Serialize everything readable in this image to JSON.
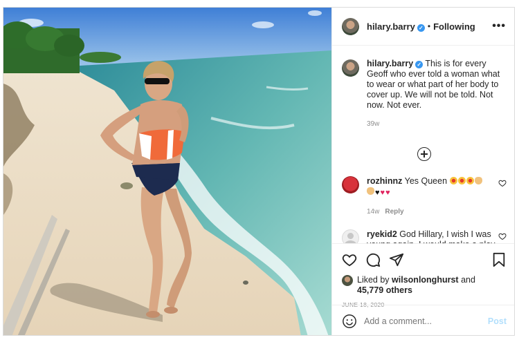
{
  "post": {
    "username": "hilary.barry",
    "follow_separator": "•",
    "follow_label": "Following",
    "more_label": "•••",
    "verified_mark": "✓"
  },
  "caption": {
    "username": "hilary.barry",
    "text": "This is for every Geoff who ever told a woman what to wear or what part of her body to cover up. We will not be told. Not now. Not ever.",
    "time": "39w"
  },
  "comments": [
    {
      "username": "rozhinnz",
      "text": "Yes Queen",
      "emoji_line1": [
        "star-struck",
        "star-struck",
        "star-struck",
        "clapping"
      ],
      "emoji_line2": [
        "clapping",
        "black-heart",
        "red-heart",
        "red-heart"
      ],
      "time": "14w",
      "reply_label": "Reply"
    },
    {
      "username": "ryekid2",
      "text": "God Hillary, I wish I was young again, I would make a play for you. You have got the x factor. Stuff all those deranged thinking"
    }
  ],
  "likes": {
    "prefix": "Liked by",
    "user": "wilsonlonghurst",
    "conj": "and",
    "count": "45,779 others"
  },
  "date": "JUNE 18, 2020",
  "add_comment": {
    "placeholder": "Add a comment...",
    "post_label": "Post"
  },
  "icons": {
    "like": "heart-icon",
    "comment": "comment-icon",
    "share": "paper-plane-icon",
    "save": "bookmark-icon",
    "emoji": "smiley-icon",
    "load_more": "plus-circle-icon"
  },
  "colors": {
    "link_blue": "#3897f0",
    "post_disabled": "#b2dffc",
    "muted": "#8e8e8e"
  }
}
